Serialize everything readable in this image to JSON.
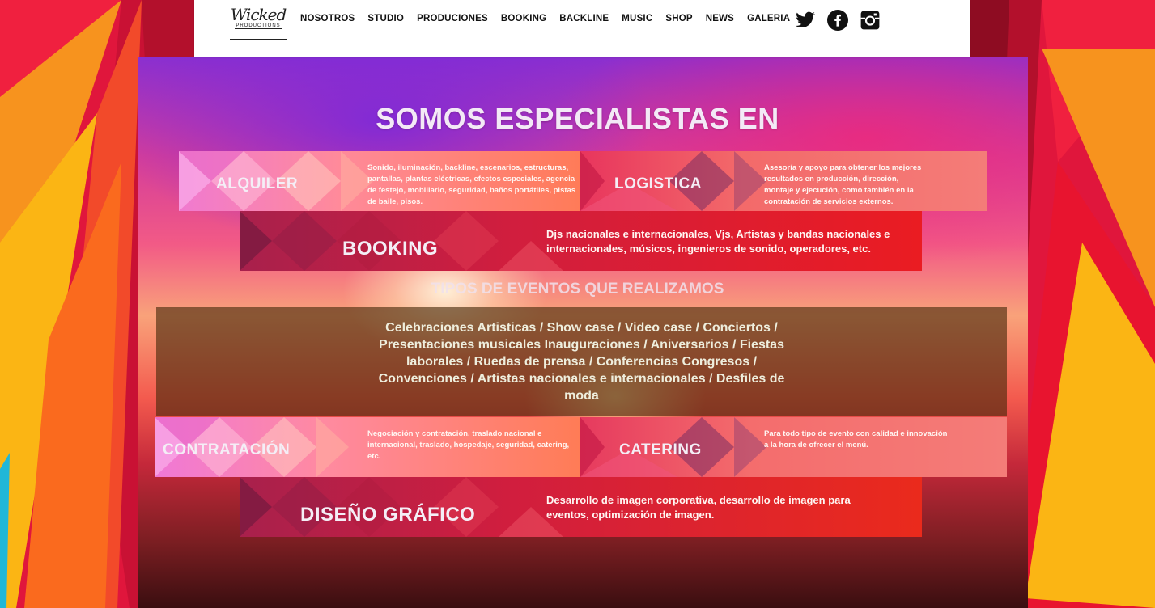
{
  "brand": {
    "logo_script": "Wicked",
    "logo_sub": "PRODUCTIONS"
  },
  "nav": {
    "items": [
      {
        "label": "NOSOTROS"
      },
      {
        "label": "STUDIO"
      },
      {
        "label": "PRODUCIONES"
      },
      {
        "label": "BOOKING"
      },
      {
        "label": "BACKLINE"
      },
      {
        "label": "MUSIC"
      },
      {
        "label": "SHOP"
      },
      {
        "label": "NEWS"
      },
      {
        "label": "GALERIA"
      }
    ],
    "social": [
      {
        "icon": "twitter-icon"
      },
      {
        "icon": "facebook-icon"
      },
      {
        "icon": "instagram-icon"
      }
    ]
  },
  "main": {
    "title": "SOMOS ESPECIALISTAS EN",
    "events_title": "TIPOS DE EVENTOS QUE REALIZAMOS",
    "events_text": "Celebraciones Artisticas / Show case / Video case / Conciertos / Presentaciones musicales Inauguraciones / Aniversarios / Fiestas laborales / Ruedas de prensa / Conferencias Congresos / Convenciones / Artistas nacionales e internacionales / Desfiles de moda"
  },
  "services": {
    "alquiler": {
      "label": "ALQUILER",
      "desc": "Sonido, iluminación, backline, escenarios, estructuras, pantallas, plantas eléctricas, efectos especiales, agencia de festejo, mobiliario, seguridad, baños portátiles, pistas de baile, pisos."
    },
    "logistica": {
      "label": "LOGISTICA",
      "desc": "Asesoría y apoyo para obtener los mejores resultados en producción, dirección, montaje y ejecución, como también en la contratación de servicios externos."
    },
    "booking": {
      "label": "BOOKING",
      "desc": "Djs nacionales e internacionales, Vjs, Artistas y bandas nacionales e internacionales, músicos, ingenieros de sonido, operadores, etc."
    },
    "contratacion": {
      "label": "CONTRATACIÓN",
      "desc": "Negociación y contratación, traslado nacional e internacional, traslado, hospedaje, seguridad, catering, etc."
    },
    "catering": {
      "label": "CATERING",
      "desc": "Para todo tipo de evento con calidad e innovación a la hora de ofrecer el menú."
    },
    "diseno": {
      "label": "DISEÑO GRÁFICO",
      "desc": "Desarrollo de imagen corporativa, desarrollo de imagen para eventos, optimización de imagen."
    }
  },
  "colors": {
    "curtain_red": "#e0163c",
    "curtain_orange": "#f7931e",
    "curtain_yellow": "#fbb514",
    "curtain_dark": "#b0102e"
  }
}
